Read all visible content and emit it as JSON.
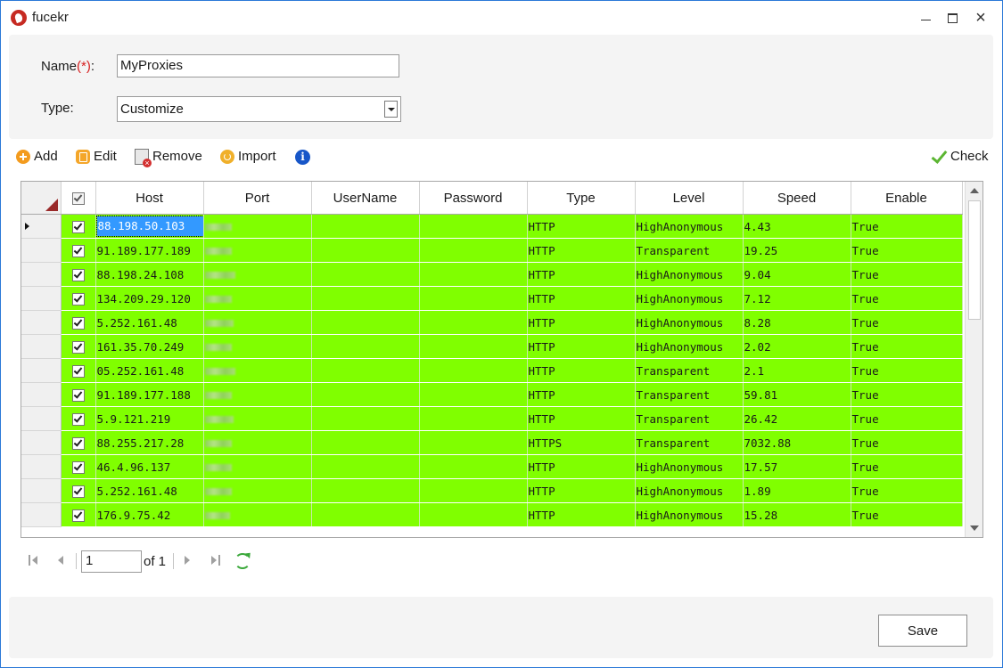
{
  "window": {
    "title": "fucekr"
  },
  "form": {
    "name_label": "Name",
    "required_mark": "(*)",
    "name_suffix": ":",
    "name_value": "MyProxies",
    "type_label": "Type:",
    "type_value": "Customize"
  },
  "toolbar": {
    "add": "Add",
    "edit": "Edit",
    "remove": "Remove",
    "import": "Import",
    "check": "Check"
  },
  "grid": {
    "columns": [
      "Host",
      "Port",
      "UserName",
      "Password",
      "Type",
      "Level",
      "Speed",
      "Enable"
    ],
    "rows": [
      {
        "host": "88.198.50.103",
        "type": "HTTP",
        "level": "HighAnonymous",
        "speed": "4.43",
        "enable": "True"
      },
      {
        "host": "91.189.177.189",
        "type": "HTTP",
        "level": "Transparent",
        "speed": "19.25",
        "enable": "True"
      },
      {
        "host": "88.198.24.108",
        "type": "HTTP",
        "level": "HighAnonymous",
        "speed": "9.04",
        "enable": "True"
      },
      {
        "host": "134.209.29.120",
        "type": "HTTP",
        "level": "HighAnonymous",
        "speed": "7.12",
        "enable": "True"
      },
      {
        "host": "5.252.161.48",
        "type": "HTTP",
        "level": "HighAnonymous",
        "speed": "8.28",
        "enable": "True"
      },
      {
        "host": "161.35.70.249",
        "type": "HTTP",
        "level": "HighAnonymous",
        "speed": "2.02",
        "enable": "True"
      },
      {
        "host": "05.252.161.48",
        "type": "HTTP",
        "level": "Transparent",
        "speed": "2.1",
        "enable": "True"
      },
      {
        "host": "91.189.177.188",
        "type": "HTTP",
        "level": "Transparent",
        "speed": "59.81",
        "enable": "True"
      },
      {
        "host": "5.9.121.219",
        "type": "HTTP",
        "level": "Transparent",
        "speed": "26.42",
        "enable": "True"
      },
      {
        "host": "88.255.217.28",
        "type": "HTTPS",
        "level": "Transparent",
        "speed": "7032.88",
        "enable": "True"
      },
      {
        "host": "46.4.96.137",
        "type": "HTTP",
        "level": "HighAnonymous",
        "speed": "17.57",
        "enable": "True"
      },
      {
        "host": "5.252.161.48",
        "type": "HTTP",
        "level": "HighAnonymous",
        "speed": "1.89",
        "enable": "True"
      },
      {
        "host": "176.9.75.42",
        "type": "HTTP",
        "level": "HighAnonymous",
        "speed": "15.28",
        "enable": "True"
      }
    ]
  },
  "pager": {
    "page_value": "1",
    "of_label": "of 1"
  },
  "footer": {
    "save": "Save"
  },
  "colors": {
    "row_bg": "#80ff00",
    "selection": "#3399ff",
    "accent_border": "#2b79d8"
  }
}
